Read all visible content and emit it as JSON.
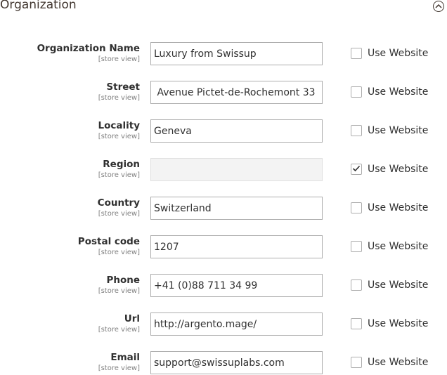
{
  "section": {
    "title": "Organization"
  },
  "fields": [
    {
      "label": "Organization Name",
      "scope": "[store view]",
      "value": "Luxury from Swissup",
      "use_website": "Use Website",
      "checked": false,
      "disabled": false
    },
    {
      "label": "Street",
      "scope": "[store view]",
      "value": " Avenue Pictet-de-Rochemont 33",
      "use_website": "Use Website",
      "checked": false,
      "disabled": false
    },
    {
      "label": "Locality",
      "scope": "[store view]",
      "value": "Geneva",
      "use_website": "Use Website",
      "checked": false,
      "disabled": false
    },
    {
      "label": "Region",
      "scope": "[store view]",
      "value": "",
      "use_website": "Use Website",
      "checked": true,
      "disabled": true
    },
    {
      "label": "Country",
      "scope": "[store view]",
      "value": "Switzerland",
      "use_website": "Use Website",
      "checked": false,
      "disabled": false
    },
    {
      "label": "Postal code",
      "scope": "[store view]",
      "value": "1207",
      "use_website": "Use Website",
      "checked": false,
      "disabled": false
    },
    {
      "label": "Phone",
      "scope": "[store view]",
      "value": "+41 (0)88 711 34 99",
      "use_website": "Use Website",
      "checked": false,
      "disabled": false
    },
    {
      "label": "Url",
      "scope": "[store view]",
      "value": "http://argento.mage/",
      "use_website": "Use Website",
      "checked": false,
      "disabled": false
    },
    {
      "label": "Email",
      "scope": "[store view]",
      "value": "support@swissuplabs.com",
      "use_website": "Use Website",
      "checked": false,
      "disabled": false
    }
  ]
}
